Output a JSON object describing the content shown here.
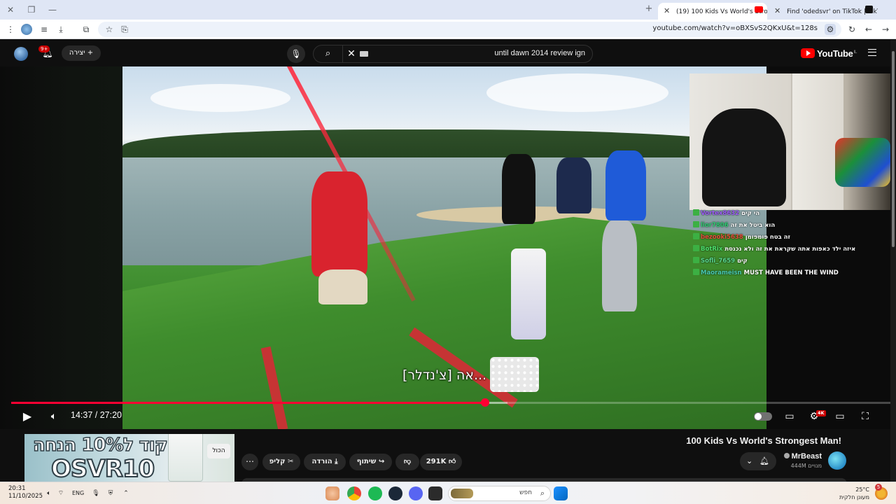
{
  "browser": {
    "tabs": [
      {
        "title": "(19) 100 Kids Vs World's Strong",
        "active": true,
        "favicon_color": "#ff0000"
      },
      {
        "title": "Find 'odedsvr' on TikTok | TikTo",
        "active": false,
        "favicon_color": "#111111"
      }
    ],
    "url": "youtube.com/watch?v=oBXSvS2QKxU&t=128s"
  },
  "youtube_header": {
    "logo_text": "YouTube",
    "logo_suffix": "IL",
    "search_query": "until dawn 2014 review ign",
    "create_label": "יצירה",
    "notification_count": "9+"
  },
  "player": {
    "subtitle": "[צ'נדלר] אה...",
    "current_time": "14:37",
    "duration": "27:20",
    "time_display": "14:37 / 27:20",
    "progress_fraction": 0.535,
    "buffered_fraction": 0.56,
    "quality_badge": "4K",
    "autoplay_on": false,
    "chat": [
      {
        "user": "Vortex8632",
        "user_color": "#9b59f5",
        "message": "הי קים"
      },
      {
        "user": "lior7806",
        "user_color": "#2ecc71",
        "message": "הוא ביטל את זה"
      },
      {
        "user": "bezooki5638",
        "user_color": "#e74c3c",
        "message": "זה בטח פומפומן"
      },
      {
        "user": "BotRix",
        "user_color": "#4ce06b",
        "message": "איזה ילד כאפות אתה שקראת את זה ולא נכנסת"
      },
      {
        "user": "Sofli_7659",
        "user_color": "#58d68d",
        "message": "קים"
      },
      {
        "user": "Maorameisn",
        "user_color": "#48c9b0",
        "message": "MUST HAVE BEEN THE WIND"
      }
    ]
  },
  "video_info": {
    "title": "100 Kids Vs World's Strongest Man!",
    "channel": "MrBeast",
    "subscribers": "444M מנויים",
    "likes": "291K",
    "share_label": "שיתוף",
    "download_label": "הורדה",
    "clip_label": "קליפ"
  },
  "ad": {
    "line1": "קוד ל10% הנחה",
    "line2": "OSVR10",
    "all_label": "הכול"
  },
  "taskbar": {
    "time": "20:31",
    "date": "11/10/2025",
    "language": "ENG",
    "search_placeholder": "חפש",
    "temperature": "25°C",
    "weather_desc": "מעונן חלקית",
    "notification_count": "5"
  }
}
